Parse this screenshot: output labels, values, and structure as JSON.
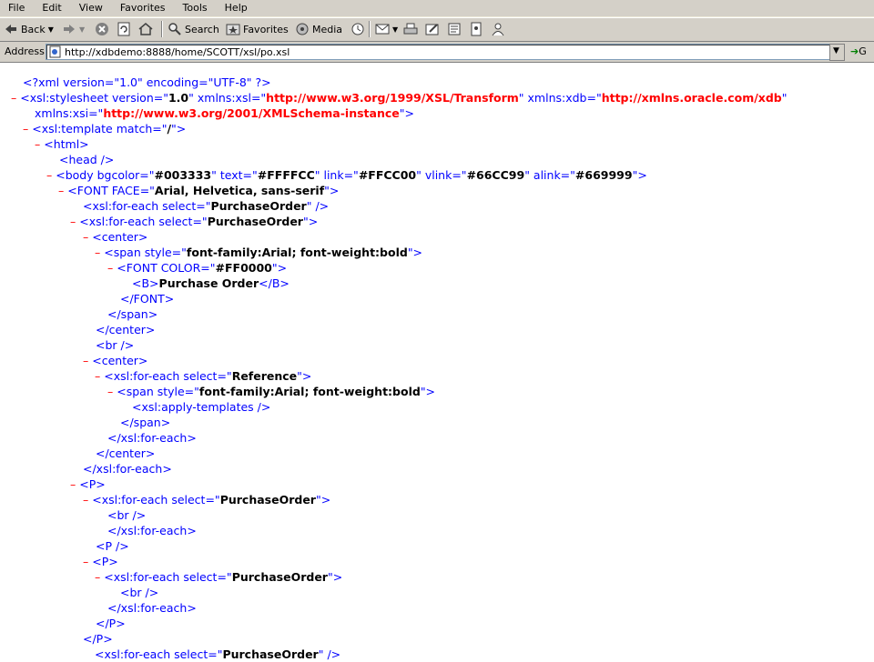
{
  "menu": [
    "File",
    "Edit",
    "View",
    "Favorites",
    "Tools",
    "Help"
  ],
  "toolbar": {
    "back": "Back",
    "search": "Search",
    "favorites": "Favorites",
    "media": "Media"
  },
  "address": {
    "label": "Address",
    "url": "http://xdbdemo:8888/home/SCOTT/xsl/po.xsl",
    "go": "G"
  },
  "xml_lines": [
    {
      "indent": 25,
      "minus": false,
      "parts": [
        [
          "b",
          "<?xml version=\"1.0\" encoding=\"UTF-8\" ?>"
        ]
      ]
    },
    {
      "indent": 12,
      "minus": true,
      "parts": [
        [
          "b",
          "<xsl:stylesheet version=\""
        ],
        [
          "k",
          "1.0"
        ],
        [
          "b",
          "\" xmlns:xsl=\""
        ],
        [
          "av",
          "http://www.w3.org/1999/XSL/Transform"
        ],
        [
          "b",
          "\" xmlns:xdb=\""
        ],
        [
          "av",
          "http://xmlns.oracle.com/xdb"
        ],
        [
          "b",
          "\""
        ]
      ]
    },
    {
      "indent": 38,
      "minus": false,
      "parts": [
        [
          "b",
          "xmlns:xsi=\""
        ],
        [
          "av",
          "http://www.w3.org/2001/XMLSchema-instance"
        ],
        [
          "b",
          "\">"
        ]
      ]
    },
    {
      "indent": 25,
      "minus": true,
      "parts": [
        [
          "b",
          "<xsl:template match=\""
        ],
        [
          "k",
          "/"
        ],
        [
          "b",
          "\">"
        ]
      ]
    },
    {
      "indent": 38,
      "minus": true,
      "parts": [
        [
          "b",
          "<html>"
        ]
      ]
    },
    {
      "indent": 65,
      "minus": false,
      "parts": [
        [
          "b",
          "<head />"
        ]
      ]
    },
    {
      "indent": 51,
      "minus": true,
      "parts": [
        [
          "b",
          "<body bgcolor=\""
        ],
        [
          "k",
          "#003333"
        ],
        [
          "b",
          "\" text=\""
        ],
        [
          "k",
          "#FFFFCC"
        ],
        [
          "b",
          "\" link=\""
        ],
        [
          "k",
          "#FFCC00"
        ],
        [
          "b",
          "\" vlink=\""
        ],
        [
          "k",
          "#66CC99"
        ],
        [
          "b",
          "\" alink=\""
        ],
        [
          "k",
          "#669999"
        ],
        [
          "b",
          "\">"
        ]
      ]
    },
    {
      "indent": 64,
      "minus": true,
      "parts": [
        [
          "b",
          "<FONT FACE=\""
        ],
        [
          "k",
          "Arial, Helvetica, sans-serif"
        ],
        [
          "b",
          "\">"
        ]
      ]
    },
    {
      "indent": 91,
      "minus": false,
      "parts": [
        [
          "b",
          "<xsl:for-each select=\""
        ],
        [
          "k",
          "PurchaseOrder"
        ],
        [
          "b",
          "\" />"
        ]
      ]
    },
    {
      "indent": 77,
      "minus": true,
      "parts": [
        [
          "b",
          "<xsl:for-each select=\""
        ],
        [
          "k",
          "PurchaseOrder"
        ],
        [
          "b",
          "\">"
        ]
      ]
    },
    {
      "indent": 91,
      "minus": true,
      "parts": [
        [
          "b",
          "<center>"
        ]
      ]
    },
    {
      "indent": 104,
      "minus": true,
      "parts": [
        [
          "b",
          "<span style=\""
        ],
        [
          "k",
          "font-family:Arial; font-weight:bold"
        ],
        [
          "b",
          "\">"
        ]
      ]
    },
    {
      "indent": 118,
      "minus": true,
      "parts": [
        [
          "b",
          "<FONT COLOR=\""
        ],
        [
          "k",
          "#FF0000"
        ],
        [
          "b",
          "\">"
        ]
      ]
    },
    {
      "indent": 145,
      "minus": false,
      "parts": [
        [
          "b",
          "<B>"
        ],
        [
          "k",
          "Purchase Order"
        ],
        [
          "b",
          "</B>"
        ]
      ]
    },
    {
      "indent": 132,
      "minus": false,
      "parts": [
        [
          "b",
          "</FONT>"
        ]
      ]
    },
    {
      "indent": 118,
      "minus": false,
      "parts": [
        [
          "b",
          "</span>"
        ]
      ]
    },
    {
      "indent": 105,
      "minus": false,
      "parts": [
        [
          "b",
          "</center>"
        ]
      ]
    },
    {
      "indent": 105,
      "minus": false,
      "parts": [
        [
          "b",
          "<br />"
        ]
      ]
    },
    {
      "indent": 91,
      "minus": true,
      "parts": [
        [
          "b",
          "<center>"
        ]
      ]
    },
    {
      "indent": 104,
      "minus": true,
      "parts": [
        [
          "b",
          "<xsl:for-each select=\""
        ],
        [
          "k",
          "Reference"
        ],
        [
          "b",
          "\">"
        ]
      ]
    },
    {
      "indent": 118,
      "minus": true,
      "parts": [
        [
          "b",
          "<span style=\""
        ],
        [
          "k",
          "font-family:Arial; font-weight:bold"
        ],
        [
          "b",
          "\">"
        ]
      ]
    },
    {
      "indent": 145,
      "minus": false,
      "parts": [
        [
          "b",
          "<xsl:apply-templates />"
        ]
      ]
    },
    {
      "indent": 132,
      "minus": false,
      "parts": [
        [
          "b",
          "</span>"
        ]
      ]
    },
    {
      "indent": 118,
      "minus": false,
      "parts": [
        [
          "b",
          "</xsl:for-each>"
        ]
      ]
    },
    {
      "indent": 105,
      "minus": false,
      "parts": [
        [
          "b",
          "</center>"
        ]
      ]
    },
    {
      "indent": 91,
      "minus": false,
      "parts": [
        [
          "b",
          "</xsl:for-each>"
        ]
      ]
    },
    {
      "indent": 77,
      "minus": true,
      "parts": [
        [
          "b",
          "<P>"
        ]
      ]
    },
    {
      "indent": 91,
      "minus": true,
      "parts": [
        [
          "b",
          "<xsl:for-each select=\""
        ],
        [
          "k",
          "PurchaseOrder"
        ],
        [
          "b",
          "\">"
        ]
      ]
    },
    {
      "indent": 118,
      "minus": false,
      "parts": [
        [
          "b",
          "<br />"
        ]
      ]
    },
    {
      "indent": 118,
      "minus": false,
      "parts": [
        [
          "b",
          "</xsl:for-each>"
        ]
      ]
    },
    {
      "indent": 105,
      "minus": false,
      "parts": [
        [
          "b",
          "<P />"
        ]
      ]
    },
    {
      "indent": 91,
      "minus": true,
      "parts": [
        [
          "b",
          "<P>"
        ]
      ]
    },
    {
      "indent": 104,
      "minus": true,
      "parts": [
        [
          "b",
          "<xsl:for-each select=\""
        ],
        [
          "k",
          "PurchaseOrder"
        ],
        [
          "b",
          "\">"
        ]
      ]
    },
    {
      "indent": 132,
      "minus": false,
      "parts": [
        [
          "b",
          "<br />"
        ]
      ]
    },
    {
      "indent": 118,
      "minus": false,
      "parts": [
        [
          "b",
          "</xsl:for-each>"
        ]
      ]
    },
    {
      "indent": 105,
      "minus": false,
      "parts": [
        [
          "b",
          "</P>"
        ]
      ]
    },
    {
      "indent": 91,
      "minus": false,
      "parts": [
        [
          "b",
          "</P>"
        ]
      ]
    },
    {
      "indent": 104,
      "minus": false,
      "parts": [
        [
          "b",
          "<xsl:for-each select=\""
        ],
        [
          "k",
          "PurchaseOrder"
        ],
        [
          "b",
          "\" />"
        ]
      ]
    }
  ],
  "colors": {
    "minus": "#ff0000",
    "markup": "#0000ff",
    "attr_value": "#ff0000",
    "value": "#000000",
    "chrome": "#d4d0c8"
  }
}
